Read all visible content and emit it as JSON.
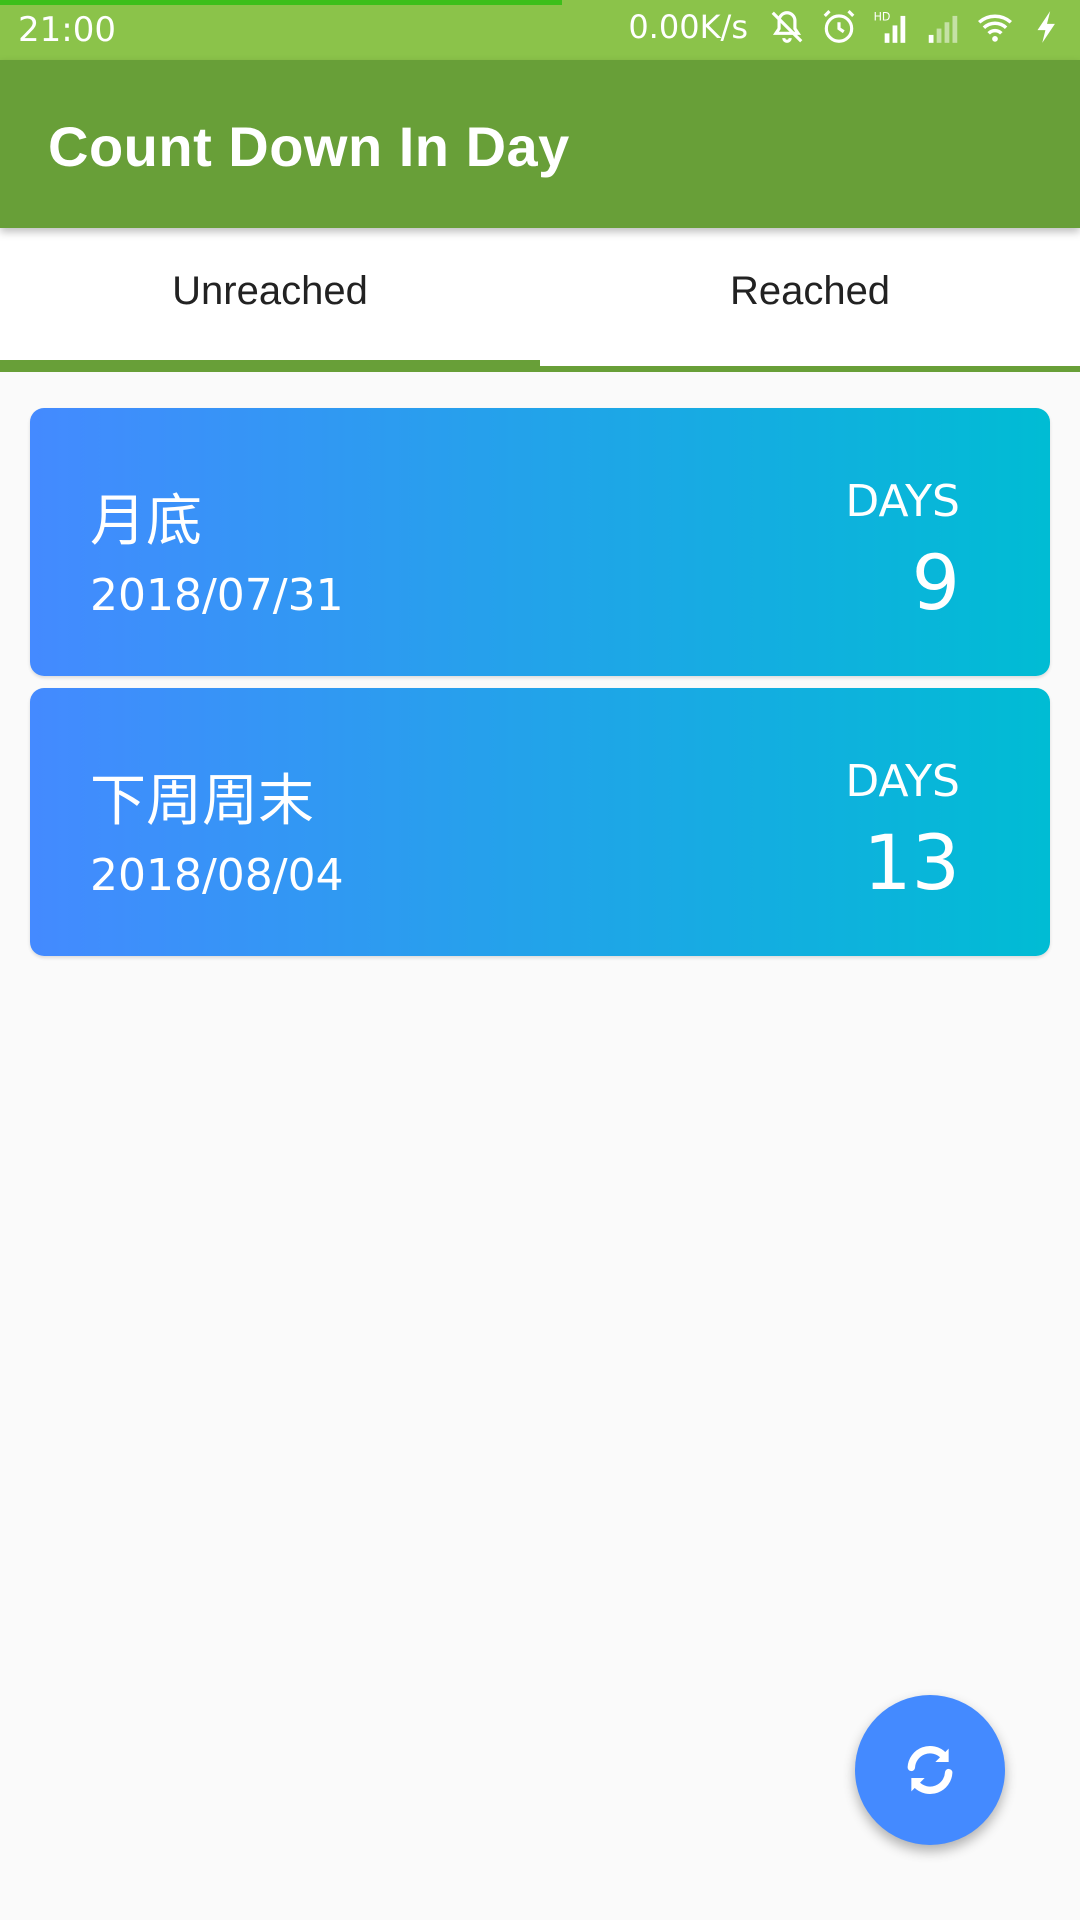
{
  "status_bar": {
    "time": "21:00",
    "network_speed": "0.00K/s",
    "hd_label": "HD",
    "download_progress": 0.52,
    "icons": [
      "bell-off-icon",
      "alarm-icon",
      "signal-hd-icon",
      "signal-weak-icon",
      "wifi-icon",
      "charging-icon"
    ]
  },
  "app_bar": {
    "title": "Count Down In Day"
  },
  "tabs": [
    {
      "label": "Unreached",
      "selected": true
    },
    {
      "label": "Reached",
      "selected": false
    }
  ],
  "events": [
    {
      "name": "月底",
      "date": "2018/07/31",
      "days_label": "DAYS",
      "days": "9"
    },
    {
      "name": "下周周末",
      "date": "2018/08/04",
      "days_label": "DAYS",
      "days": "13"
    }
  ],
  "fab": {
    "icon": "refresh-icon"
  },
  "colors": {
    "status_bar": "#8bc34a",
    "app_bar": "#689f38",
    "card_gradient_start": "#448aff",
    "card_gradient_end": "#00bcd4",
    "fab": "#448aff"
  }
}
